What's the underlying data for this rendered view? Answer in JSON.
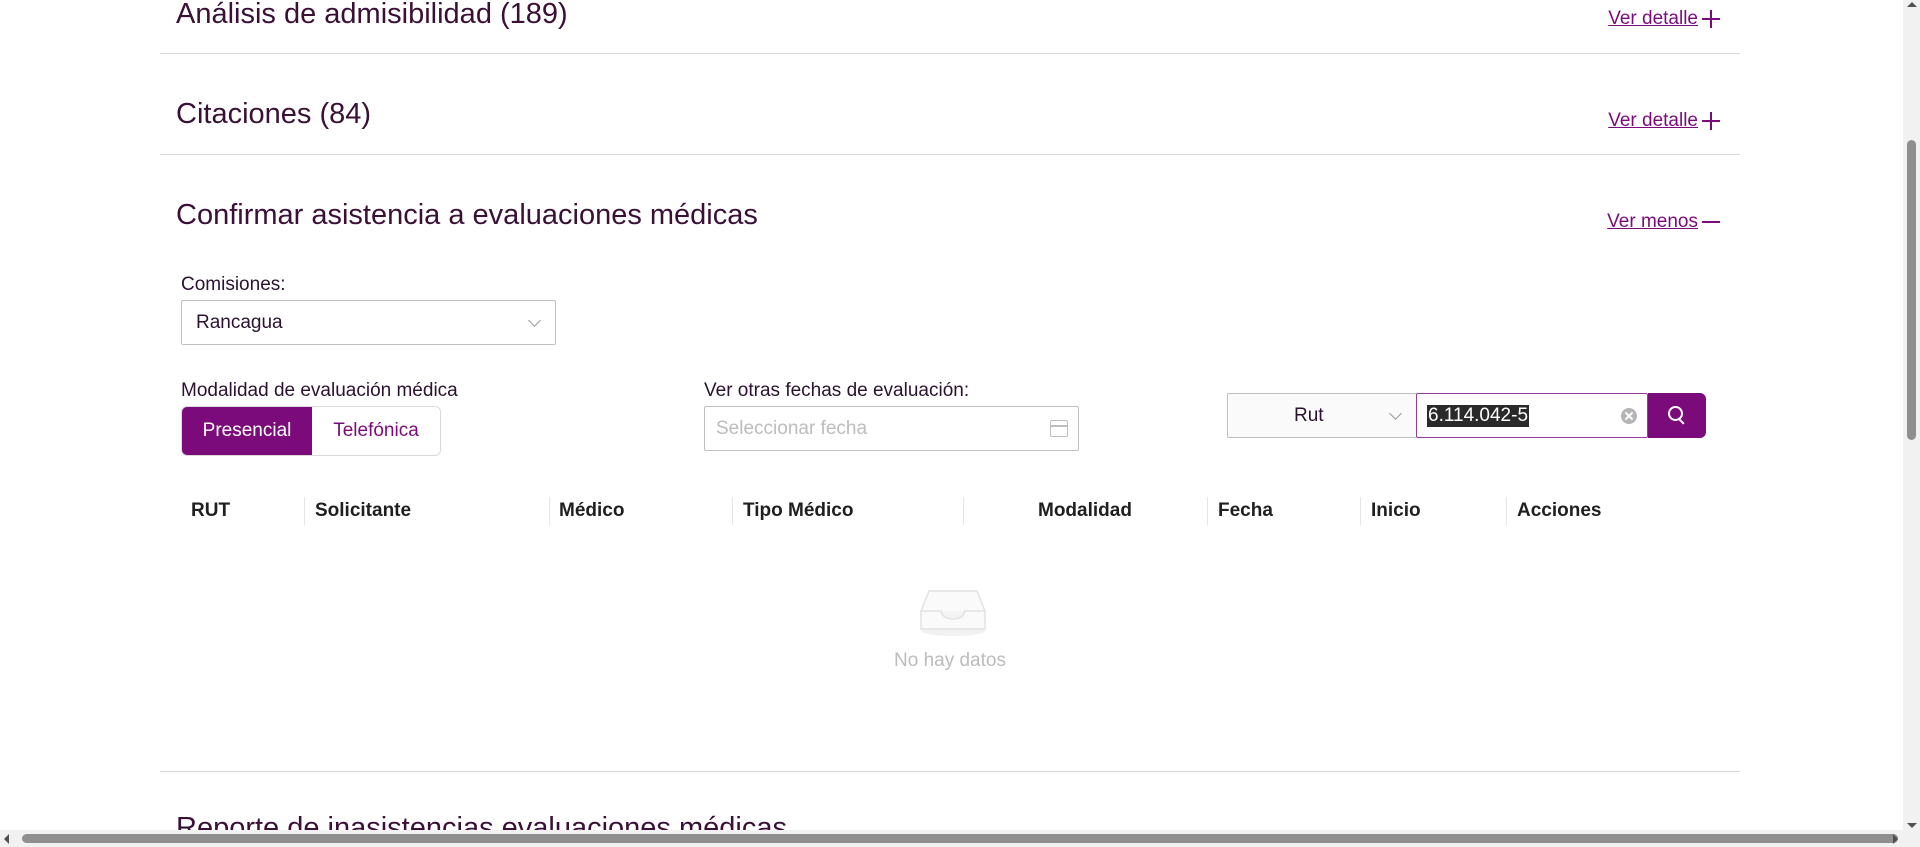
{
  "sections": {
    "admisibilidad": {
      "title": "Análisis de admisibilidad (189)",
      "link": "Ver detalle"
    },
    "citaciones": {
      "title": "Citaciones (84)",
      "link": "Ver detalle"
    },
    "confirmar": {
      "title": "Confirmar asistencia a evaluaciones médicas",
      "link": "Ver menos"
    },
    "next_title": "Reporte de inasistencias evaluaciones médicas"
  },
  "filters": {
    "comisiones_label": "Comisiones:",
    "comisiones_value": "Rancagua",
    "modalidad_label": "Modalidad de evaluación médica",
    "modalidad_options": [
      "Presencial",
      "Telefónica"
    ],
    "fechas_label": "Ver otras fechas de evaluación:",
    "fecha_placeholder": "Seleccionar fecha",
    "search_type": "Rut",
    "search_value": "6.114.042-5"
  },
  "table": {
    "columns": [
      "RUT",
      "Solicitante",
      "Médico",
      "Tipo Médico",
      "Modalidad",
      "Fecha",
      "Inicio",
      "Acciones"
    ],
    "empty_text": "No hay datos"
  },
  "colors": {
    "accent": "#7b0b7b",
    "title": "#3a1036"
  }
}
